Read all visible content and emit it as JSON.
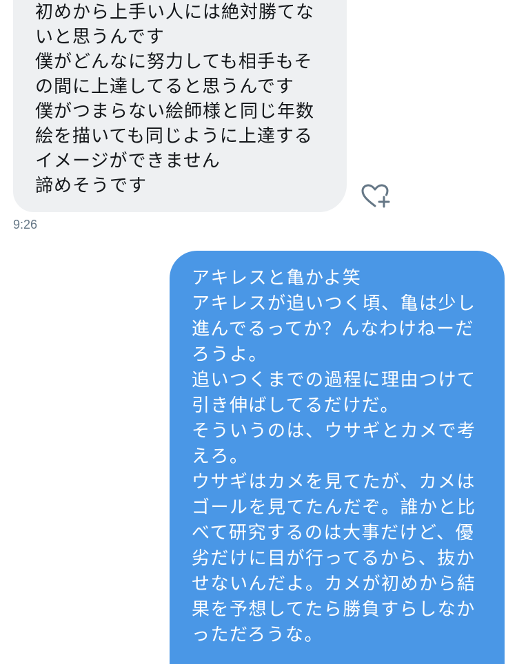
{
  "incoming_message": {
    "lines": [
      "初めから上手い人には絶対勝てな",
      "いと思うんです",
      "僕がどんなに努力しても相手もそ",
      "の間に上達してると思うんです",
      "僕がつまらない絵師様と同じ年数",
      "絵を描いても同じように上達する",
      "イメージができません",
      "諦めそうです"
    ],
    "timestamp": "9:26",
    "react_icon": "heart-plus-icon"
  },
  "outgoing_message": {
    "lines": [
      "アキレスと亀かよ笑",
      "アキレスが追いつく頃、亀は少し",
      "進んでるってか？んなわけねーだ",
      "ろうよ。",
      "追いつくまでの過程に理由つけて",
      "引き伸ばしてるだけだ。",
      "そういうのは、ウサギとカメで考",
      "えろ。",
      "ウサギはカメを見てたが、カメは",
      "ゴールを見てたんだぞ。誰かと比",
      "べて研究するのは大事だけど、優",
      "劣だけに目が行ってるから、抜か",
      "せないんだよ。カメが初めから結",
      "果を予想してたら勝負すらしなか",
      "っただろうな。"
    ]
  },
  "colors": {
    "incoming_bubble": "#eef0f2",
    "outgoing_bubble": "#4a97e6",
    "timestamp": "#657786"
  }
}
